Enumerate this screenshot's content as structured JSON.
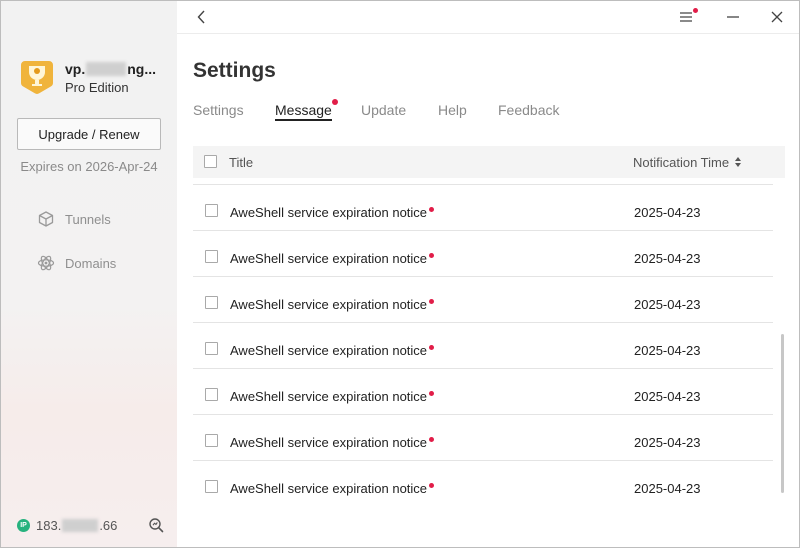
{
  "sidebar": {
    "user": {
      "name_prefix": "vp.",
      "name_suffix": "ng...",
      "plan": "Pro Edition"
    },
    "upgrade_label": "Upgrade / Renew",
    "expires": "Expires on 2026-Apr-24",
    "nav": [
      {
        "label": "Tunnels",
        "icon": "cube-icon"
      },
      {
        "label": "Domains",
        "icon": "atom-icon"
      }
    ],
    "ip": {
      "badge": "IP",
      "prefix": "183.",
      "suffix": ".66"
    }
  },
  "main": {
    "title": "Settings",
    "tabs": [
      {
        "label": "Settings",
        "active": false,
        "badge": false
      },
      {
        "label": "Message",
        "active": true,
        "badge": true
      },
      {
        "label": "Update",
        "active": false,
        "badge": false
      },
      {
        "label": "Help",
        "active": false,
        "badge": false
      },
      {
        "label": "Feedback",
        "active": false,
        "badge": false
      }
    ],
    "table": {
      "columns": [
        "Title",
        "Notification Time"
      ],
      "rows": [
        {
          "title": "AweShell service expiration notice",
          "time": "2025-04-23",
          "unread": true
        },
        {
          "title": "AweShell service expiration notice",
          "time": "2025-04-23",
          "unread": true
        },
        {
          "title": "AweShell service expiration notice",
          "time": "2025-04-23",
          "unread": true
        },
        {
          "title": "AweShell service expiration notice",
          "time": "2025-04-23",
          "unread": true
        },
        {
          "title": "AweShell service expiration notice",
          "time": "2025-04-23",
          "unread": true
        },
        {
          "title": "AweShell service expiration notice",
          "time": "2025-04-23",
          "unread": true
        },
        {
          "title": "AweShell service expiration notice",
          "time": "2025-04-23",
          "unread": true
        }
      ]
    }
  },
  "colors": {
    "accent_red": "#e11d48",
    "ip_green": "#27b27e",
    "avatar_gold": "#f0b43c"
  }
}
